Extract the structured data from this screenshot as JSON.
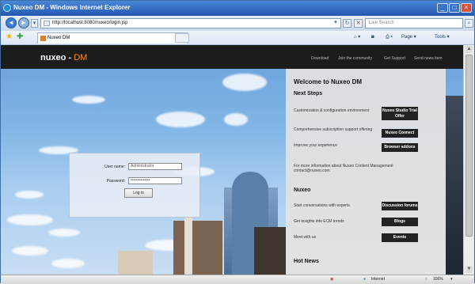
{
  "window": {
    "title": "Nuxeo DM - Windows Internet Explorer"
  },
  "address_bar": {
    "url": "http://localhost:8080/nuxeo/login.jsp"
  },
  "search": {
    "placeholder": "Live Search"
  },
  "tabs": [
    {
      "label": "Nuxeo DM"
    }
  ],
  "command_bar": {
    "page_label": "Page",
    "tools_label": "Tools"
  },
  "site": {
    "logo_main": "nuxeo",
    "logo_sep": " - ",
    "logo_accent": "DM",
    "top_links": [
      "Download",
      "Join the community",
      "Get Support",
      "Send news item"
    ]
  },
  "login": {
    "username_label": "User name:",
    "username_value": "Administrator",
    "password_label": "Password:",
    "password_value": "••••••••••••••",
    "button_label": "Log in"
  },
  "welcome": {
    "heading": "Welcome to Nuxeo DM",
    "next_steps_heading": "Next Steps",
    "steps": [
      {
        "text": "Customization & configuration environment",
        "button": "Nuxeo Studio Trial Offer"
      },
      {
        "text": "Comprehensive subscription support offering",
        "button": "Nuxeo Connect"
      },
      {
        "text": "Improve your experience",
        "button": "Browser addons"
      }
    ],
    "contact_text": "For more information about Nuxeo Content Management contact@nuxeo.com",
    "more_heading": "Nuxeo",
    "more_items": [
      {
        "text": "Start conversations with experts",
        "button": "Discussion forums"
      },
      {
        "text": "Get insights into ECM trends",
        "button": "Blogs"
      },
      {
        "text": "Meet with us",
        "button": "Events"
      }
    ],
    "news_heading": "Hot News"
  },
  "status": {
    "zone": "Internet",
    "zoom": "100%"
  }
}
